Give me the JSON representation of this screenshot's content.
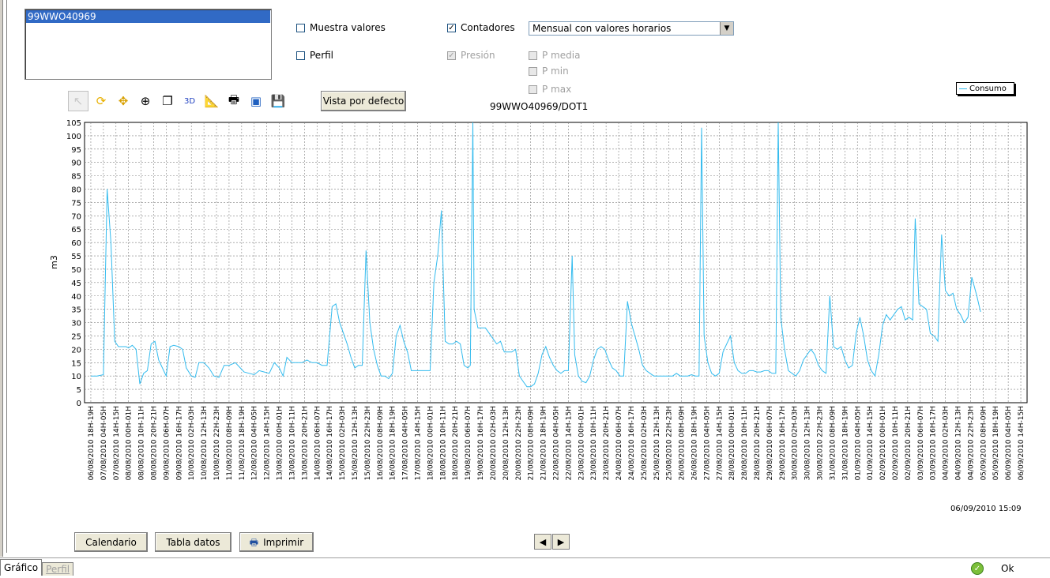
{
  "meter_list": {
    "selected": "99WWO40969"
  },
  "options": {
    "muestra_valores": {
      "label": "Muestra valores",
      "checked": false
    },
    "perfil": {
      "label": "Perfil",
      "checked": false
    },
    "contadores": {
      "label": "Contadores",
      "checked": true
    },
    "presion": {
      "label": "Presión",
      "checked": true,
      "disabled": true
    },
    "p_media": {
      "label": "P media",
      "disabled": true
    },
    "p_min": {
      "label": "P min",
      "disabled": true
    },
    "p_max": {
      "label": "P max",
      "disabled": true
    }
  },
  "mode_select": {
    "value": "Mensual con valores horarios"
  },
  "toolbar": {
    "icons": [
      "pointer-icon",
      "refresh-icon",
      "pan-icon",
      "zoom-icon",
      "copy-icon",
      "3d-icon",
      "axis-edit-icon",
      "print-icon",
      "chart-export-icon",
      "save-icon"
    ],
    "label_3d": "3D",
    "default_view_label": "Vista por defecto"
  },
  "chart_data": {
    "type": "line",
    "title": "99WWO40969/DOT1",
    "ylabel": "m3",
    "ylim": [
      0,
      105
    ],
    "ytick_step": 5,
    "grid": true,
    "legend": {
      "entries": [
        "Consumo"
      ],
      "placement": "top-right"
    },
    "colors": {
      "series": "#33bbee",
      "grid": "#808080"
    },
    "x_labels": [
      "06/08/2010 18H-19H",
      "07/08/2010 04H-05H",
      "07/08/2010 14H-15H",
      "08/08/2010 00H-01H",
      "08/08/2010 10H-11H",
      "08/08/2010 20H-21H",
      "09/08/2010 06H-07H",
      "09/08/2010 16H-17H",
      "10/08/2010 02H-03H",
      "10/08/2010 12H-13H",
      "10/08/2010 22H-23H",
      "11/08/2010 08H-09H",
      "11/08/2010 18H-19H",
      "12/08/2010 04H-05H",
      "12/08/2010 14H-15H",
      "13/08/2010 00H-01H",
      "13/08/2010 10H-11H",
      "13/08/2010 20H-21H",
      "14/08/2010 06H-07H",
      "14/08/2010 16H-17H",
      "15/08/2010 02H-03H",
      "15/08/2010 12H-13H",
      "15/08/2010 22H-23H",
      "16/08/2010 08H-09H",
      "16/08/2010 18H-19H",
      "17/08/2010 04H-05H",
      "17/08/2010 14H-15H",
      "18/08/2010 00H-01H",
      "18/08/2010 10H-11H",
      "18/08/2010 20H-21H",
      "19/08/2010 06H-07H",
      "19/08/2010 16H-17H",
      "20/08/2010 02H-03H",
      "20/08/2010 12H-13H",
      "20/08/2010 22H-23H",
      "21/08/2010 08H-09H",
      "21/08/2010 18H-19H",
      "22/08/2010 04H-05H",
      "22/08/2010 14H-15H",
      "23/08/2010 00H-01H",
      "23/08/2010 10H-11H",
      "23/08/2010 20H-21H",
      "24/08/2010 06H-07H",
      "24/08/2010 16H-17H",
      "25/08/2010 02H-03H",
      "25/08/2010 12H-13H",
      "25/08/2010 22H-23H",
      "26/08/2010 08H-09H",
      "26/08/2010 18H-19H",
      "27/08/2010 04H-05H",
      "27/08/2010 14H-15H",
      "28/08/2010 00H-01H",
      "28/08/2010 10H-11H",
      "28/08/2010 20H-21H",
      "29/08/2010 06H-07H",
      "29/08/2010 16H-17H",
      "30/08/2010 02H-03H",
      "30/08/2010 12H-13H",
      "30/08/2010 22H-23H",
      "31/08/2010 08H-09H",
      "31/08/2010 18H-19H",
      "01/09/2010 04H-05H",
      "01/09/2010 14H-15H",
      "02/09/2010 00H-01H",
      "02/09/2010 10H-11H",
      "02/09/2010 20H-21H",
      "03/09/2010 06H-07H",
      "03/09/2010 16H-17H",
      "04/09/2010 02H-03H",
      "04/09/2010 12H-13H",
      "04/09/2010 22H-23H",
      "05/09/2010 08H-09H",
      "05/09/2010 18H-19H",
      "06/09/2010 04H-05H",
      "06/09/2010 14H-15H"
    ],
    "series": [
      {
        "name": "Consumo",
        "points": [
          [
            0,
            10
          ],
          [
            0.5,
            10
          ],
          [
            1,
            10.5
          ],
          [
            1.3,
            80
          ],
          [
            1.6,
            60
          ],
          [
            1.9,
            23
          ],
          [
            2.2,
            21
          ],
          [
            2.5,
            21
          ],
          [
            2.8,
            21
          ],
          [
            3,
            20.5
          ],
          [
            3.3,
            21.5
          ],
          [
            3.6,
            20
          ],
          [
            3.9,
            7
          ],
          [
            4.2,
            11
          ],
          [
            4.5,
            12
          ],
          [
            4.8,
            22
          ],
          [
            5.1,
            23
          ],
          [
            5.4,
            16
          ],
          [
            5.7,
            13
          ],
          [
            6,
            10
          ],
          [
            6.3,
            21
          ],
          [
            6.6,
            21.5
          ],
          [
            7,
            21
          ],
          [
            7.3,
            20
          ],
          [
            7.6,
            13
          ],
          [
            8,
            10
          ],
          [
            8.3,
            9.5
          ],
          [
            8.6,
            15
          ],
          [
            9,
            15
          ],
          [
            9.4,
            13
          ],
          [
            9.8,
            10
          ],
          [
            10.2,
            9.5
          ],
          [
            10.6,
            14
          ],
          [
            11,
            14
          ],
          [
            11.5,
            15
          ],
          [
            11.9,
            13
          ],
          [
            12.2,
            11.5
          ],
          [
            12.6,
            11
          ],
          [
            13,
            10.5
          ],
          [
            13.4,
            12
          ],
          [
            13.8,
            11.5
          ],
          [
            14.2,
            11
          ],
          [
            14.6,
            15
          ],
          [
            15,
            13
          ],
          [
            15.3,
            10
          ],
          [
            15.6,
            17
          ],
          [
            16,
            15
          ],
          [
            16.4,
            15
          ],
          [
            16.8,
            15
          ],
          [
            17.2,
            16
          ],
          [
            17.6,
            15
          ],
          [
            18,
            15
          ],
          [
            18.4,
            14
          ],
          [
            18.8,
            14
          ],
          [
            19.2,
            36
          ],
          [
            19.5,
            37
          ],
          [
            19.8,
            30
          ],
          [
            20.1,
            26
          ],
          [
            20.4,
            22
          ],
          [
            20.7,
            17
          ],
          [
            21,
            13
          ],
          [
            21.3,
            14
          ],
          [
            21.6,
            14
          ],
          [
            21.9,
            57
          ],
          [
            22.2,
            30
          ],
          [
            22.5,
            20
          ],
          [
            22.8,
            14
          ],
          [
            23.1,
            10
          ],
          [
            23.4,
            10
          ],
          [
            23.7,
            9
          ],
          [
            24,
            11
          ],
          [
            24.3,
            25
          ],
          [
            24.6,
            29
          ],
          [
            24.9,
            23
          ],
          [
            25.2,
            19
          ],
          [
            25.5,
            12
          ],
          [
            25.8,
            12
          ],
          [
            26.1,
            12
          ],
          [
            26.4,
            12
          ],
          [
            26.7,
            12
          ],
          [
            27,
            12
          ],
          [
            27.3,
            45
          ],
          [
            27.6,
            55
          ],
          [
            27.9,
            72
          ],
          [
            28.2,
            23
          ],
          [
            28.5,
            22
          ],
          [
            28.8,
            22
          ],
          [
            29.1,
            23
          ],
          [
            29.4,
            22
          ],
          [
            29.7,
            14
          ],
          [
            30,
            13
          ],
          [
            30.2,
            14
          ],
          [
            30.4,
            105
          ],
          [
            30.5,
            35
          ],
          [
            30.8,
            28
          ],
          [
            31.1,
            28
          ],
          [
            31.4,
            28
          ],
          [
            31.7,
            26
          ],
          [
            32,
            24
          ],
          [
            32.3,
            22
          ],
          [
            32.6,
            23
          ],
          [
            32.9,
            19
          ],
          [
            33.2,
            19
          ],
          [
            33.5,
            19
          ],
          [
            33.8,
            20
          ],
          [
            34.1,
            10
          ],
          [
            34.4,
            8
          ],
          [
            34.7,
            6
          ],
          [
            35,
            6
          ],
          [
            35.3,
            7
          ],
          [
            35.6,
            11
          ],
          [
            35.9,
            18
          ],
          [
            36.2,
            21
          ],
          [
            36.5,
            17
          ],
          [
            36.8,
            14
          ],
          [
            37.1,
            12
          ],
          [
            37.4,
            11
          ],
          [
            37.7,
            12
          ],
          [
            38,
            12
          ],
          [
            38.3,
            55
          ],
          [
            38.5,
            18
          ],
          [
            38.8,
            10
          ],
          [
            39.1,
            8
          ],
          [
            39.4,
            7.5
          ],
          [
            39.7,
            10
          ],
          [
            40,
            16
          ],
          [
            40.3,
            20
          ],
          [
            40.6,
            21
          ],
          [
            40.9,
            20
          ],
          [
            41.2,
            16
          ],
          [
            41.5,
            13
          ],
          [
            41.8,
            12
          ],
          [
            42.1,
            10
          ],
          [
            42.4,
            10
          ],
          [
            42.7,
            38
          ],
          [
            43,
            30
          ],
          [
            43.3,
            25
          ],
          [
            43.6,
            20
          ],
          [
            43.9,
            14
          ],
          [
            44.2,
            12
          ],
          [
            44.5,
            11
          ],
          [
            44.8,
            10
          ],
          [
            45.1,
            10
          ],
          [
            45.4,
            10
          ],
          [
            45.7,
            10
          ],
          [
            46,
            10
          ],
          [
            46.3,
            10
          ],
          [
            46.6,
            11
          ],
          [
            46.9,
            10
          ],
          [
            47.2,
            10
          ],
          [
            47.5,
            10
          ],
          [
            47.8,
            10.5
          ],
          [
            48.1,
            10
          ],
          [
            48.4,
            10
          ],
          [
            48.6,
            103
          ],
          [
            48.8,
            25
          ],
          [
            49.1,
            15
          ],
          [
            49.4,
            11
          ],
          [
            49.7,
            10
          ],
          [
            50,
            11
          ],
          [
            50.3,
            19
          ],
          [
            50.6,
            22
          ],
          [
            50.9,
            25
          ],
          [
            51.2,
            15
          ],
          [
            51.5,
            12
          ],
          [
            51.8,
            11
          ],
          [
            52.1,
            11
          ],
          [
            52.4,
            12
          ],
          [
            52.7,
            12
          ],
          [
            53,
            11.5
          ],
          [
            53.3,
            11.5
          ],
          [
            53.6,
            12
          ],
          [
            53.9,
            12
          ],
          [
            54.2,
            11
          ],
          [
            54.5,
            11
          ],
          [
            54.7,
            105
          ],
          [
            54.9,
            32
          ],
          [
            55.2,
            20
          ],
          [
            55.5,
            12
          ],
          [
            55.8,
            11
          ],
          [
            56.1,
            10
          ],
          [
            56.4,
            12
          ],
          [
            56.7,
            16
          ],
          [
            57,
            18
          ],
          [
            57.3,
            20
          ],
          [
            57.6,
            18
          ],
          [
            57.9,
            14
          ],
          [
            58.2,
            12
          ],
          [
            58.5,
            11
          ],
          [
            58.8,
            40
          ],
          [
            59.1,
            21
          ],
          [
            59.4,
            20
          ],
          [
            59.7,
            21
          ],
          [
            60,
            16
          ],
          [
            60.3,
            13
          ],
          [
            60.6,
            14
          ],
          [
            60.9,
            26
          ],
          [
            61.2,
            32
          ],
          [
            61.5,
            25
          ],
          [
            61.8,
            16
          ],
          [
            62.1,
            12
          ],
          [
            62.4,
            10
          ],
          [
            62.7,
            18
          ],
          [
            63,
            29
          ],
          [
            63.3,
            33
          ],
          [
            63.6,
            31
          ],
          [
            63.9,
            33
          ],
          [
            64.2,
            35
          ],
          [
            64.5,
            36
          ],
          [
            64.8,
            31
          ],
          [
            65.1,
            32
          ],
          [
            65.4,
            31
          ],
          [
            65.6,
            69
          ],
          [
            65.9,
            37
          ],
          [
            66.2,
            36
          ],
          [
            66.5,
            35
          ],
          [
            66.8,
            26
          ],
          [
            67.1,
            25
          ],
          [
            67.4,
            23
          ],
          [
            67.7,
            63
          ],
          [
            68,
            42
          ],
          [
            68.3,
            40
          ],
          [
            68.6,
            41
          ],
          [
            68.9,
            35
          ],
          [
            69.2,
            33
          ],
          [
            69.5,
            30
          ],
          [
            69.8,
            32
          ],
          [
            70.1,
            47
          ],
          [
            70.5,
            40
          ],
          [
            70.8,
            34
          ]
        ]
      }
    ]
  },
  "timestamp": "06/09/2010 15:09",
  "bottom_buttons": {
    "calendario": "Calendario",
    "tabla_datos": "Tabla datos",
    "imprimir": "Imprimir"
  },
  "nav": {
    "prev": "◀",
    "next": "▶"
  },
  "tabs": {
    "grafico": "Gráfico",
    "perfil": "Perfil"
  },
  "status": {
    "ok": "Ok"
  }
}
